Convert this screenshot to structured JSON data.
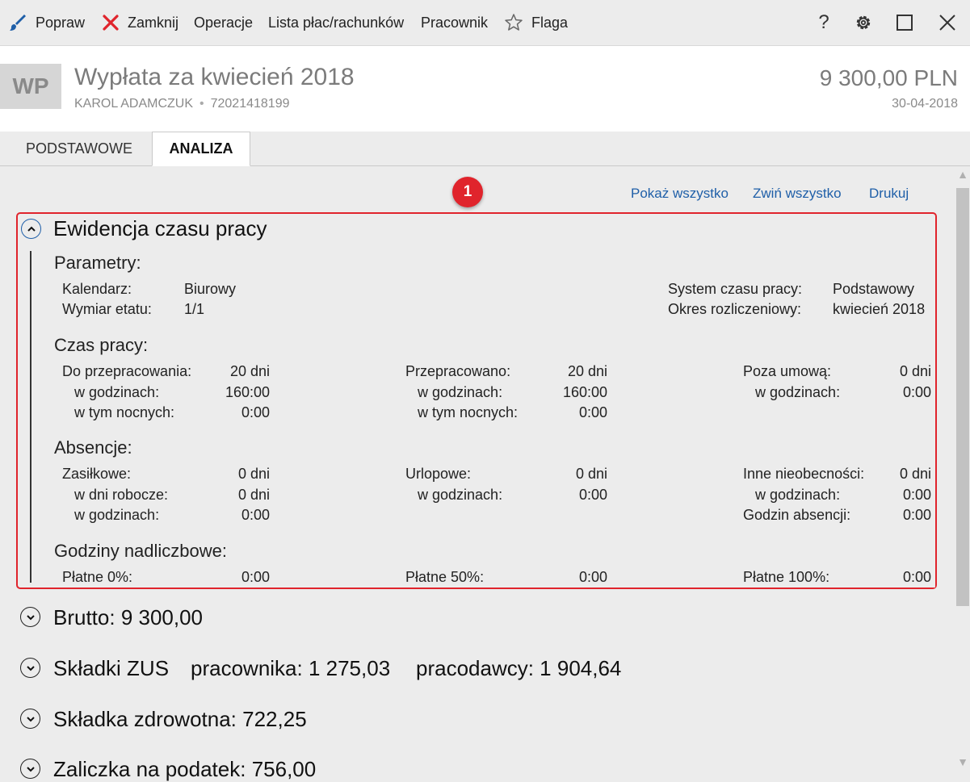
{
  "toolbar": {
    "popraw": "Popraw",
    "zamknij": "Zamknij",
    "operacje": "Operacje",
    "lista": "Lista płac/rachunków",
    "pracownik": "Pracownik",
    "flaga": "Flaga",
    "help": "?"
  },
  "header": {
    "avatar": "WP",
    "title": "Wypłata za kwiecień 2018",
    "employee": "KAROL ADAMCZUK",
    "dot": "•",
    "pesel": "72021418199",
    "amount": "9 300,00 PLN",
    "date": "30-04-2018"
  },
  "tabs": {
    "podstawowe": "PODSTAWOWE",
    "analiza": "ANALIZA"
  },
  "links": {
    "pokaz": "Pokaż wszystko",
    "zwin": "Zwiń wszystko",
    "drukuj": "Drukuj"
  },
  "badge": "1",
  "ewidencja": {
    "title": "Ewidencja czasu pracy",
    "parametry": {
      "heading": "Parametry:",
      "kalendarz_label": "Kalendarz:",
      "kalendarz": "Biurowy",
      "wymiar_label": "Wymiar etatu:",
      "wymiar": "1/1",
      "system_label": "System czasu pracy:",
      "system": "Podstawowy",
      "okres_label": "Okres rozliczeniowy:",
      "okres": "kwiecień 2018"
    },
    "czas": {
      "heading": "Czas pracy:",
      "do_label": "Do przepracowania:",
      "do": "20 dni",
      "do_godz_label": "w godzinach:",
      "do_godz": "160:00",
      "do_noc_label": "w tym nocnych:",
      "do_noc": "0:00",
      "prz_label": "Przepracowano:",
      "prz": "20 dni",
      "prz_godz_label": "w godzinach:",
      "prz_godz": "160:00",
      "prz_noc_label": "w tym nocnych:",
      "prz_noc": "0:00",
      "poza_label": "Poza umową:",
      "poza": "0 dni",
      "poza_godz_label": "w godzinach:",
      "poza_godz": "0:00"
    },
    "absencje": {
      "heading": "Absencje:",
      "zas_label": "Zasiłkowe:",
      "zas": "0 dni",
      "zas_dni_label": "w dni robocze:",
      "zas_dni": "0 dni",
      "zas_godz_label": "w godzinach:",
      "zas_godz": "0:00",
      "url_label": "Urlopowe:",
      "url": "0 dni",
      "url_godz_label": "w godzinach:",
      "url_godz": "0:00",
      "inne_label": "Inne nieobecności:",
      "inne": "0 dni",
      "inne_godz_label": "w godzinach:",
      "inne_godz": "0:00",
      "godz_abs_label": "Godzin absencji:",
      "godz_abs": "0:00"
    },
    "nadliczbowe": {
      "heading": "Godziny nadliczbowe:",
      "p0_label": "Płatne 0%:",
      "p0": "0:00",
      "p50_label": "Płatne 50%:",
      "p50": "0:00",
      "p100_label": "Płatne 100%:",
      "p100": "0:00"
    }
  },
  "sections": {
    "brutto": "Brutto:  9 300,00",
    "zus": "Składki ZUS",
    "zus_prac": "pracownika: 1 275,03",
    "zus_pracod": "pracodawcy: 1 904,64",
    "zdrowotna": "Składka zdrowotna: 722,25",
    "zaliczka": "Zaliczka na podatek:  756,00"
  },
  "colors": {
    "accent": "#1f5fa8",
    "highlight": "#e0242c",
    "close_x": "#e0242c"
  }
}
